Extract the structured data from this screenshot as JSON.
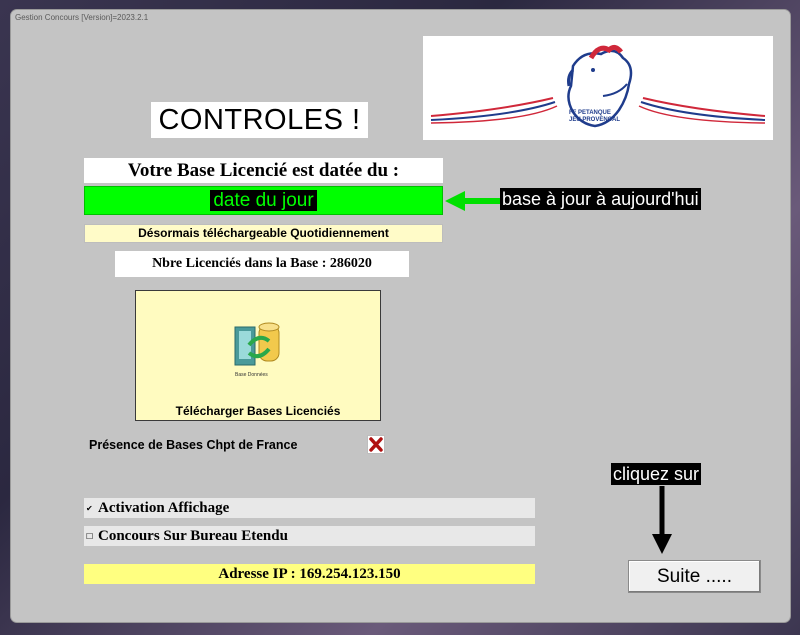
{
  "window": {
    "title": "Gestion Concours [Version]=2023.2.1"
  },
  "header": {
    "heading": "CONTROLES !"
  },
  "logo": {
    "text": "FF PETANQUE JEU PROVENCAL"
  },
  "license": {
    "base_date_label": "Votre Base Licencié est datée du :",
    "date_value": "date du jour",
    "download_note": "Désormais téléchargeable Quotidiennement",
    "count_label": "Nbre Licenciés dans la Base : 286020"
  },
  "download_button": {
    "label": "Télécharger Bases Licenciés",
    "icon_caption": "Base  Données"
  },
  "presence": {
    "label": "Présence de Bases Chpt de France",
    "status_icon": "red-cross-icon"
  },
  "options": [
    {
      "label": "Activation Affichage",
      "checked": true
    },
    {
      "label": "Concours Sur Bureau Etendu",
      "checked": false
    }
  ],
  "ip": {
    "label": "Adresse IP : 169.254.123.150"
  },
  "annotations": {
    "base_note": "base à jour à aujourd'hui",
    "click_note": "cliquez sur"
  },
  "suite_button": {
    "label": "Suite ....."
  },
  "colors": {
    "green": "#00ff00",
    "pale_yellow": "#fffbc8",
    "ip_yellow": "#ffff80",
    "window_bg": "#c4c4c4"
  }
}
